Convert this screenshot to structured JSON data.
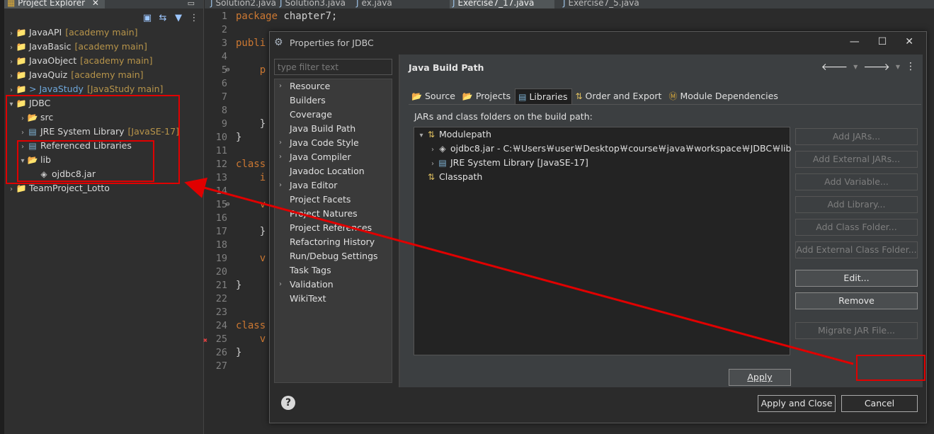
{
  "explorer": {
    "tab_label": "Project Explorer",
    "tab_close": "✕",
    "minimize": "▭",
    "tree": [
      {
        "label": "JavaAPI",
        "decoration": "[academy main]",
        "type": "project",
        "expanded": false
      },
      {
        "label": "JavaBasic",
        "decoration": "[academy main]",
        "type": "project",
        "expanded": false
      },
      {
        "label": "JavaObject",
        "decoration": "[academy main]",
        "type": "project",
        "expanded": false
      },
      {
        "label": "JavaQuiz",
        "decoration": "[academy main]",
        "type": "project",
        "expanded": false
      },
      {
        "label": "> JavaStudy",
        "decoration": "[JavaStudy main]",
        "type": "project",
        "expanded": false
      },
      {
        "label": "JDBC",
        "decoration": "",
        "type": "project",
        "expanded": true
      },
      {
        "label": "src",
        "decoration": "",
        "type": "folder",
        "expanded": false
      },
      {
        "label": "JRE System Library",
        "decoration": "[JavaSE-17]",
        "type": "library",
        "expanded": false
      },
      {
        "label": "Referenced Libraries",
        "decoration": "",
        "type": "library",
        "expanded": false
      },
      {
        "label": "lib",
        "decoration": "",
        "type": "folder",
        "expanded": true
      },
      {
        "label": "ojdbc8.jar",
        "decoration": "",
        "type": "jar",
        "expanded": false
      },
      {
        "label": "TeamProject_Lotto",
        "decoration": "",
        "type": "project",
        "expanded": false
      }
    ]
  },
  "editor": {
    "tabs": [
      {
        "label": "Solution2.java",
        "active": false
      },
      {
        "label": "Solution3.java",
        "active": false
      },
      {
        "label": "ex.java",
        "active": false
      },
      {
        "label": "Exercise7_17.java",
        "active": true
      },
      {
        "label": "Exercise7_5.java",
        "active": false
      }
    ],
    "line_numbers": [
      "1",
      "2",
      "3",
      "4",
      "5",
      "6",
      "7",
      "8",
      "9",
      "10",
      "11",
      "12",
      "13",
      "14",
      "15",
      "16",
      "17",
      "18",
      "19",
      "20",
      "21",
      "22",
      "23",
      "24",
      "25",
      "26",
      "27"
    ],
    "lines": [
      [
        "package",
        " chapter7;"
      ],
      [
        "",
        ""
      ],
      [
        "publi",
        ""
      ],
      [
        "",
        ""
      ],
      [
        "    p",
        ""
      ],
      [
        "",
        ""
      ],
      [
        "",
        ""
      ],
      [
        "",
        ""
      ],
      [
        "",
        "    }"
      ],
      [
        "",
        "}"
      ],
      [
        "",
        ""
      ],
      [
        "class",
        ""
      ],
      [
        "    i",
        ""
      ],
      [
        "",
        ""
      ],
      [
        "    v",
        ""
      ],
      [
        "",
        ""
      ],
      [
        "",
        "    }"
      ],
      [
        "",
        ""
      ],
      [
        "    v",
        ""
      ],
      [
        "",
        ""
      ],
      [
        "",
        "}"
      ],
      [
        "",
        ""
      ],
      [
        "",
        ""
      ],
      [
        "class",
        ""
      ],
      [
        "    v",
        ""
      ],
      [
        "",
        "}"
      ],
      [
        "",
        ""
      ]
    ]
  },
  "dialog": {
    "title": "Properties for JDBC",
    "win_controls": [
      "—",
      "☐",
      "✕"
    ],
    "filter_placeholder": "type filter text",
    "categories": [
      {
        "label": "Resource",
        "chevron": true
      },
      {
        "label": "Builders",
        "chevron": false
      },
      {
        "label": "Coverage",
        "chevron": false
      },
      {
        "label": "Java Build Path",
        "chevron": false
      },
      {
        "label": "Java Code Style",
        "chevron": true
      },
      {
        "label": "Java Compiler",
        "chevron": true
      },
      {
        "label": "Javadoc Location",
        "chevron": false
      },
      {
        "label": "Java Editor",
        "chevron": true
      },
      {
        "label": "Project Facets",
        "chevron": false
      },
      {
        "label": "Project Natures",
        "chevron": false
      },
      {
        "label": "Project References",
        "chevron": false
      },
      {
        "label": "Refactoring History",
        "chevron": false
      },
      {
        "label": "Run/Debug Settings",
        "chevron": false
      },
      {
        "label": "Task Tags",
        "chevron": false
      },
      {
        "label": "Validation",
        "chevron": true
      },
      {
        "label": "WikiText",
        "chevron": false
      }
    ],
    "section_title": "Java Build Path",
    "tabs": [
      {
        "label": "Source",
        "icon": "source-icon",
        "active": false
      },
      {
        "label": "Projects",
        "icon": "projects-icon",
        "active": false
      },
      {
        "label": "Libraries",
        "icon": "libraries-icon",
        "active": true
      },
      {
        "label": "Order and Export",
        "icon": "order-icon",
        "active": false
      },
      {
        "label": "Module Dependencies",
        "icon": "module-icon",
        "active": false
      }
    ],
    "jars_label": "JARs and class folders on the build path:",
    "classpath_tree": [
      {
        "label": "Modulepath",
        "level": 0,
        "expanded": true
      },
      {
        "label": "ojdbc8.jar - C:￦Users￦user￦Desktop￦course￦java￦workspace￦JDBC￦lib",
        "level": 1,
        "expanded": false
      },
      {
        "label": "JRE System Library [JavaSE-17]",
        "level": 1,
        "expanded": false
      },
      {
        "label": "Classpath",
        "level": 0,
        "expanded": false
      }
    ],
    "side_buttons": [
      {
        "label": "Add JARs...",
        "enabled": false
      },
      {
        "label": "Add External JARs...",
        "enabled": false
      },
      {
        "label": "Add Variable...",
        "enabled": false
      },
      {
        "label": "Add Library...",
        "enabled": false
      },
      {
        "label": "Add Class Folder...",
        "enabled": false
      },
      {
        "label": "Add External Class Folder...",
        "enabled": false
      },
      {
        "label": "Edit...",
        "enabled": true
      },
      {
        "label": "Remove",
        "enabled": true
      },
      {
        "label": "Migrate JAR File...",
        "enabled": false
      }
    ],
    "apply": "Apply",
    "help": "?",
    "apply_and_close": "Apply and Close",
    "cancel": "Cancel"
  },
  "colors": {
    "annotation": "#e00000",
    "decoration": "#b7944a"
  }
}
